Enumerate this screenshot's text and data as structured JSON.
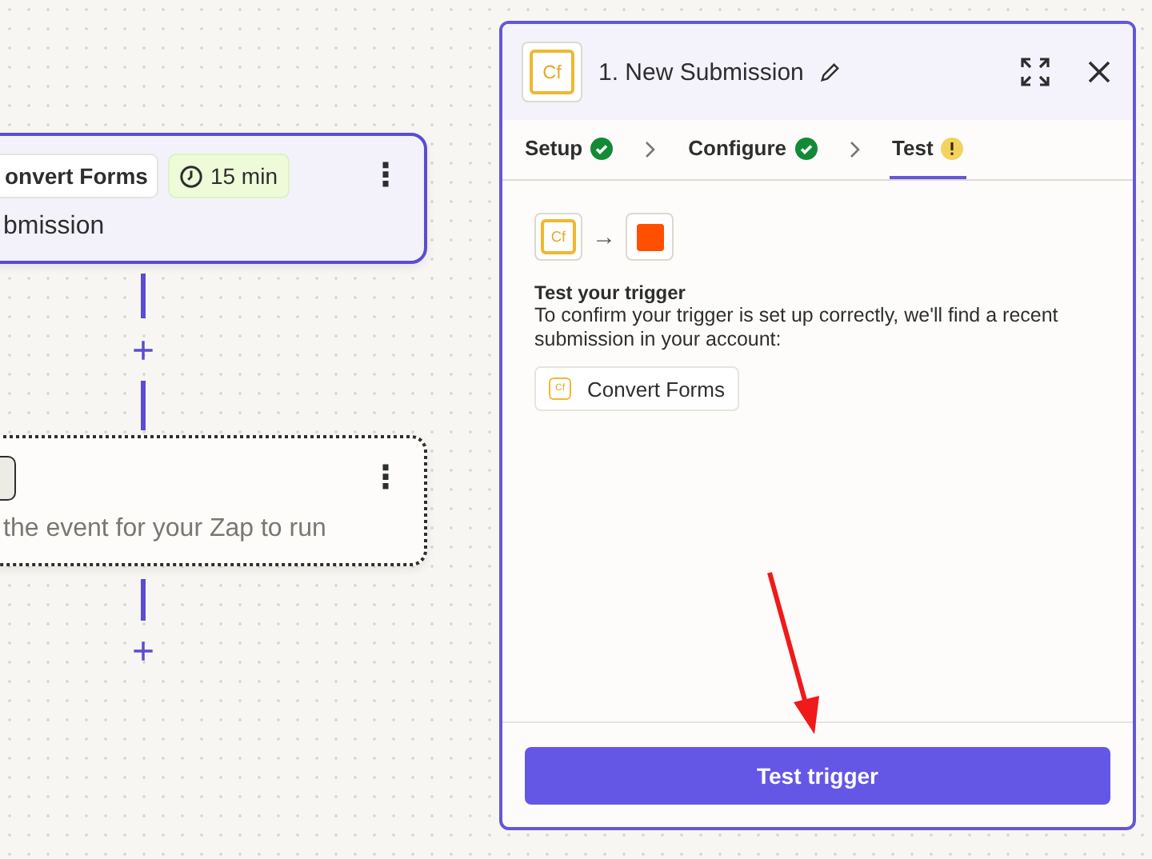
{
  "canvas": {
    "trigger_step": {
      "app_badge": "onvert Forms",
      "time_badge": "15 min",
      "title": "bmission",
      "menu": "⋮"
    },
    "action_step": {
      "description": "the event for your Zap to run",
      "menu": "⋮"
    },
    "add_buttons": [
      "+",
      "+"
    ]
  },
  "panel": {
    "icon_text": "Cf",
    "title": "1. New Submission",
    "steps": [
      {
        "label": "Setup",
        "kind": "done",
        "selected": false
      },
      {
        "label": "Configure",
        "kind": "done",
        "selected": false
      },
      {
        "label": "Test",
        "kind": "warning",
        "selected": true
      }
    ],
    "flow_icons": {
      "source_text": "Cf",
      "arrow": "→"
    },
    "heading": "Test your trigger",
    "body": "To confirm your trigger is set up correctly, we'll find a recent submission in your account:",
    "account": {
      "icon_text": "Cf",
      "label": "Convert Forms"
    },
    "button": "Test trigger"
  },
  "annotation": {
    "kind": "arrow",
    "color": "#f01a1a"
  }
}
